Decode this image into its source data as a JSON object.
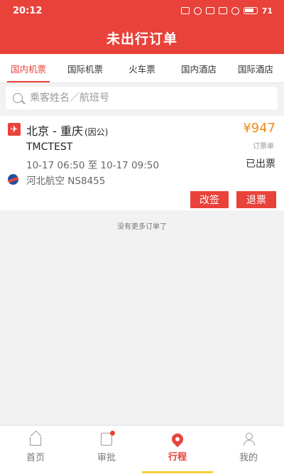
{
  "status_bar": {
    "time": "20:12",
    "battery": "71"
  },
  "header": {
    "title": "未出行订单"
  },
  "tabs": [
    {
      "label": "国内机票",
      "active": true
    },
    {
      "label": "国际机票",
      "active": false
    },
    {
      "label": "火车票",
      "active": false
    },
    {
      "label": "国内酒店",
      "active": false
    },
    {
      "label": "国际酒店",
      "active": false
    }
  ],
  "search": {
    "placeholder": "乘客姓名／航班号"
  },
  "order": {
    "route": "北京 - 重庆",
    "route_tag": "(因公)",
    "price": "¥947",
    "price_label": "订票单",
    "passenger": "TMCTEST",
    "time": "10-17 06:50 至 10-17 09:50",
    "status": "已出票",
    "airline": "河北航空 NS8455",
    "change_label": "改签",
    "refund_label": "退票"
  },
  "no_more": "没有更多订单了",
  "bottom_nav": [
    {
      "label": "首页",
      "icon": "home-icon"
    },
    {
      "label": "审批",
      "icon": "approval-icon"
    },
    {
      "label": "行程",
      "icon": "trip-pin-icon",
      "active": true
    },
    {
      "label": "我的",
      "icon": "user-icon"
    }
  ],
  "colors": {
    "primary": "#e8423a",
    "price": "#f08a1c",
    "indicator": "#f7d03a"
  }
}
